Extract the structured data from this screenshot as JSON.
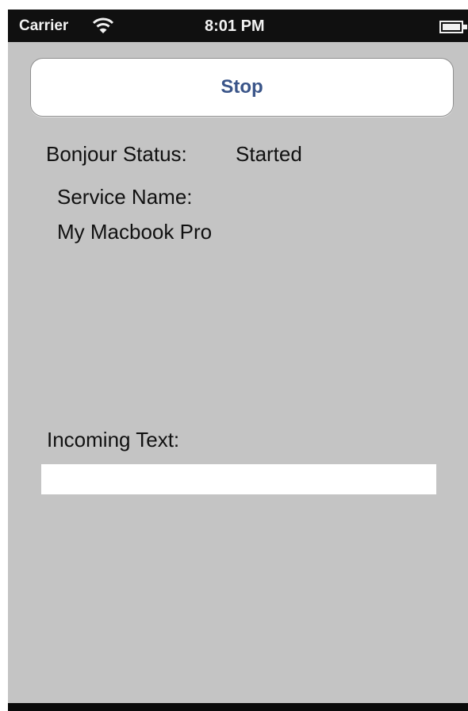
{
  "status_bar": {
    "carrier": "Carrier",
    "time": "8:01 PM",
    "wifi_icon": "wifi-icon",
    "battery_icon": "battery-icon"
  },
  "toolbar": {
    "stop_label": "Stop"
  },
  "bonjour": {
    "status_label": "Bonjour Status:",
    "status_value": "Started"
  },
  "service": {
    "name_label": "Service Name:",
    "name_value": "My Macbook Pro"
  },
  "incoming": {
    "label": "Incoming Text:",
    "value": "",
    "placeholder": ""
  },
  "colors": {
    "background": "#c4c4c4",
    "status_bar": "#101010",
    "button_text": "#3a5589",
    "field": "#ffffff"
  }
}
